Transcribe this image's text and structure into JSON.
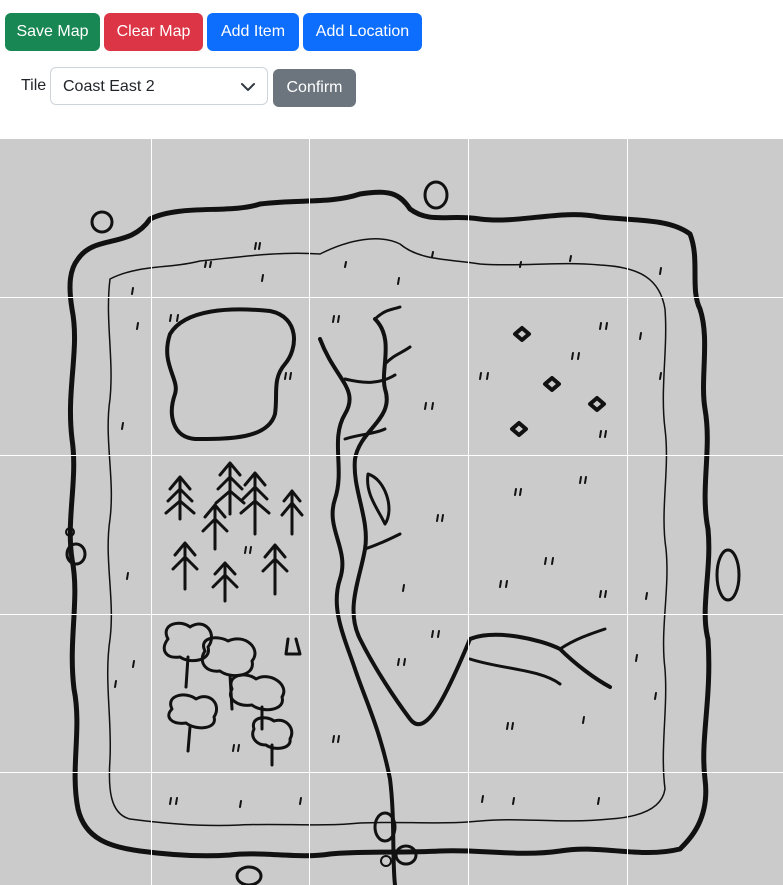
{
  "toolbar": {
    "save_label": "Save Map",
    "clear_label": "Clear Map",
    "add_item_label": "Add Item",
    "add_location_label": "Add Location"
  },
  "tile_selector": {
    "label": "Tile",
    "selected": "Coast East 2",
    "confirm_label": "Confirm"
  },
  "colors": {
    "success": "#198754",
    "danger": "#dc3545",
    "primary": "#0d6efd",
    "secondary": "#6c757d",
    "map_background": "#cbcbcb",
    "grid_line": "#ffffff"
  },
  "map": {
    "grid": {
      "columns": 5,
      "rows": 5
    }
  }
}
